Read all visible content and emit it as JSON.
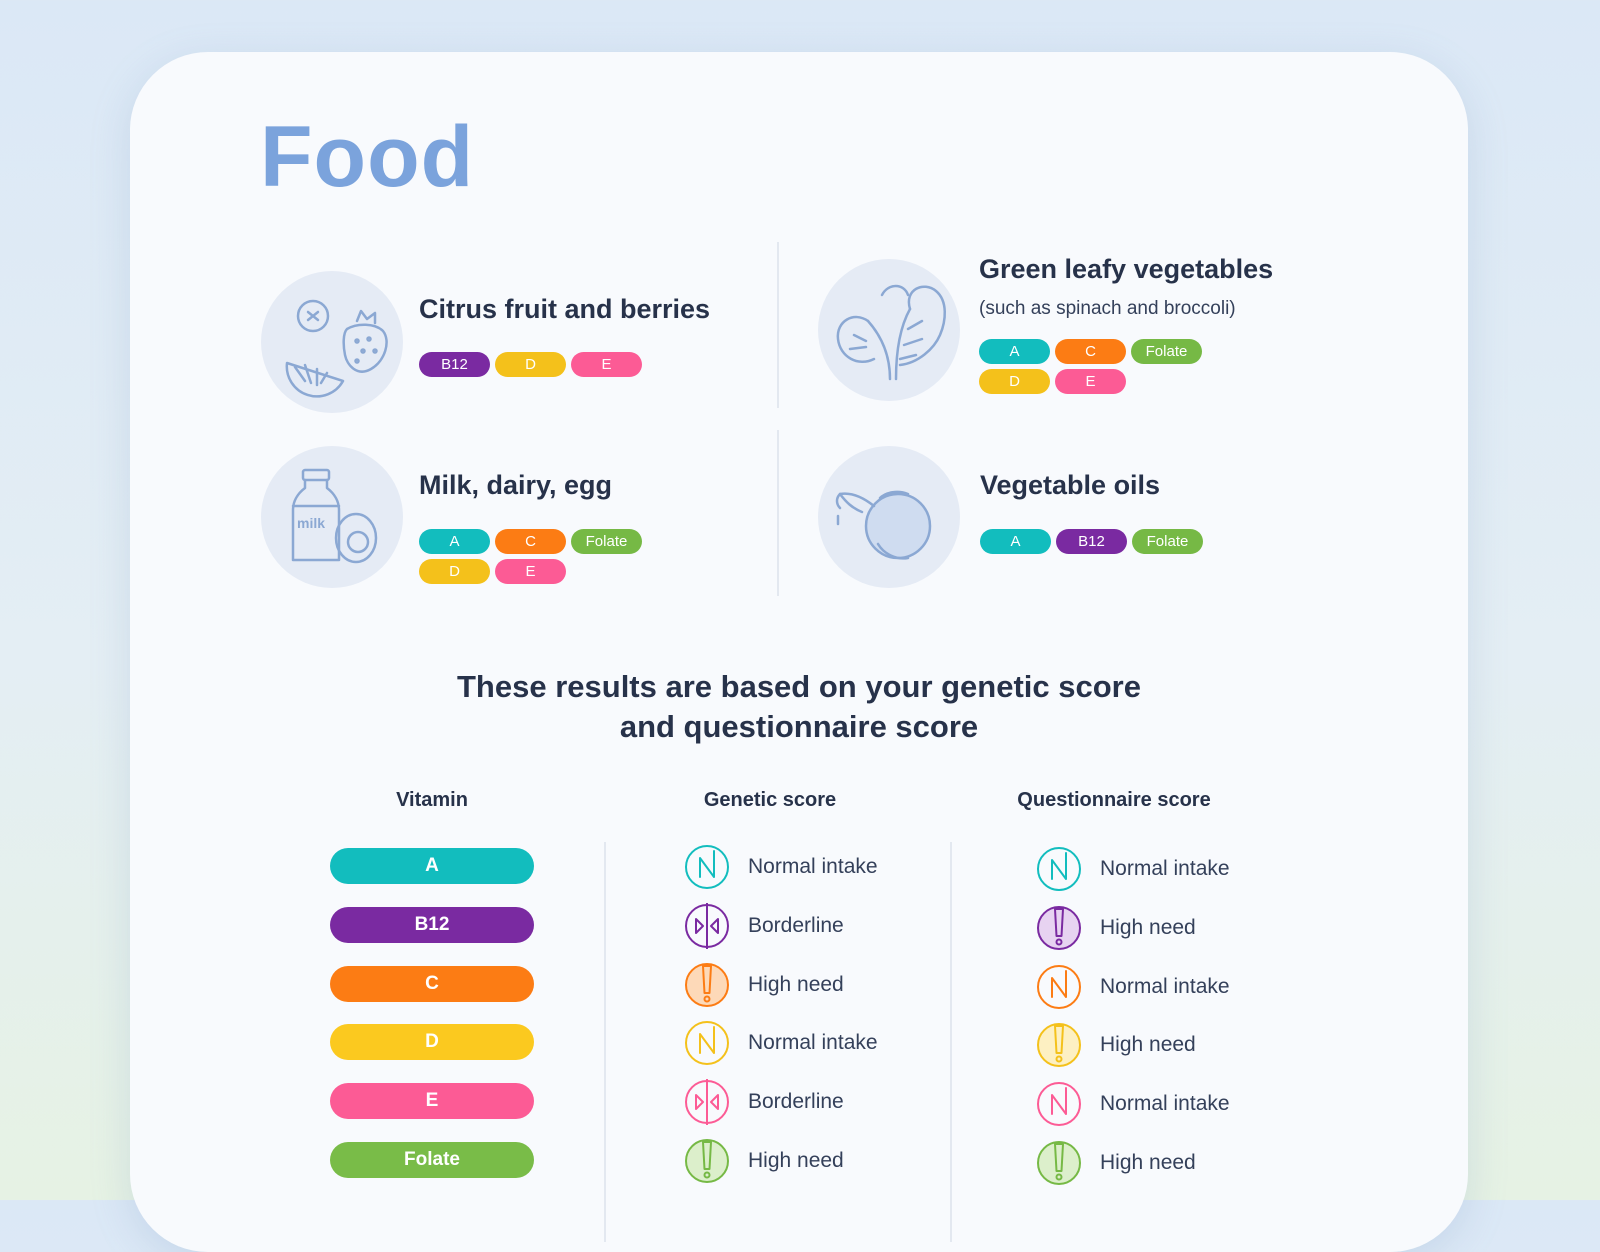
{
  "page": {
    "title": "Food"
  },
  "foods": [
    {
      "id": "citrus",
      "title": "Citrus fruit and berries",
      "subtitle": "",
      "icon": "citrus-berry-icon",
      "chips": [
        {
          "label": "B12",
          "color": "#7a2aa1"
        },
        {
          "label": "D",
          "color": "#f4c11b"
        },
        {
          "label": "E",
          "color": "#fc5b95"
        }
      ]
    },
    {
      "id": "greens",
      "title": "Green leafy vegetables",
      "subtitle": "(such as spinach and broccoli)",
      "icon": "leafy-greens-icon",
      "chips": [
        {
          "label": "A",
          "color": "#12bdbe"
        },
        {
          "label": "C",
          "color": "#fc7c14"
        },
        {
          "label": "Folate",
          "color": "#76b945"
        },
        {
          "label": "D",
          "color": "#f4c11b"
        },
        {
          "label": "E",
          "color": "#fc5b95"
        }
      ]
    },
    {
      "id": "dairy",
      "title": "Milk, dairy, egg",
      "subtitle": "",
      "icon": "milk-egg-icon",
      "icon_text": "milk",
      "chips": [
        {
          "label": "A",
          "color": "#12bdbe"
        },
        {
          "label": "C",
          "color": "#fc7c14"
        },
        {
          "label": "Folate",
          "color": "#76b945"
        },
        {
          "label": "D",
          "color": "#f4c11b"
        },
        {
          "label": "E",
          "color": "#fc5b95"
        }
      ]
    },
    {
      "id": "oils",
      "title": "Vegetable oils",
      "subtitle": "",
      "icon": "oil-jug-icon",
      "chips": [
        {
          "label": "A",
          "color": "#12bdbe"
        },
        {
          "label": "B12",
          "color": "#7a2aa1"
        },
        {
          "label": "Folate",
          "color": "#76b945"
        }
      ]
    }
  ],
  "results": {
    "heading_line1": "These results are based on your genetic score",
    "heading_line2": "and questionnaire score",
    "columns": {
      "vitamin": "Vitamin",
      "genetic": "Genetic score",
      "questionnaire": "Questionnaire score"
    },
    "rows": [
      {
        "vitamin": "A",
        "color": "#12bdbe",
        "genetic": {
          "label": "Normal intake",
          "icon": "normal-intake-icon"
        },
        "questionnaire": {
          "label": "Normal intake",
          "icon": "normal-intake-icon"
        }
      },
      {
        "vitamin": "B12",
        "color": "#7a2aa1",
        "genetic": {
          "label": "Borderline",
          "icon": "borderline-icon"
        },
        "questionnaire": {
          "label": "High need",
          "icon": "high-need-icon"
        }
      },
      {
        "vitamin": "C",
        "color": "#fc7c14",
        "genetic": {
          "label": "High need",
          "icon": "high-need-icon"
        },
        "questionnaire": {
          "label": "Normal intake",
          "icon": "normal-intake-icon"
        }
      },
      {
        "vitamin": "D",
        "color": "#f4c11b",
        "genetic": {
          "label": "Normal intake",
          "icon": "normal-intake-icon"
        },
        "questionnaire": {
          "label": "High need",
          "icon": "high-need-icon"
        }
      },
      {
        "vitamin": "E",
        "color": "#fc5b95",
        "genetic": {
          "label": "Borderline",
          "icon": "borderline-icon"
        },
        "questionnaire": {
          "label": "Normal intake",
          "icon": "normal-intake-icon"
        }
      },
      {
        "vitamin": "Folate",
        "color": "#76b945",
        "genetic": {
          "label": "High need",
          "icon": "high-need-icon"
        },
        "questionnaire": {
          "label": "High need",
          "icon": "high-need-icon"
        }
      }
    ]
  }
}
